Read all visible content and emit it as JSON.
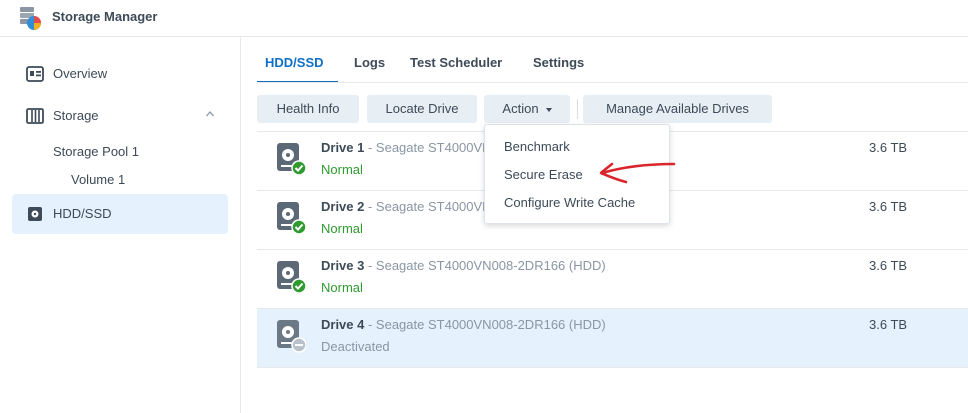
{
  "app": {
    "title": "Storage Manager"
  },
  "sidebar": {
    "items": [
      {
        "label": "Overview",
        "icon": "overview-icon"
      },
      {
        "label": "Storage",
        "icon": "storage-icon",
        "expanded": true
      },
      {
        "label": "HDD/SSD",
        "icon": "hdd-icon",
        "active": true
      }
    ],
    "storage_children": [
      {
        "label": "Storage Pool 1"
      },
      {
        "label": "Volume 1"
      }
    ]
  },
  "tabs": [
    {
      "label": "HDD/SSD",
      "active": true
    },
    {
      "label": "Logs"
    },
    {
      "label": "Test Scheduler"
    },
    {
      "label": "Settings"
    }
  ],
  "toolbar": {
    "health_info": "Health Info",
    "locate_drive": "Locate Drive",
    "action": "Action",
    "manage_drives": "Manage Available Drives"
  },
  "action_menu": {
    "items": [
      "Benchmark",
      "Secure Erase",
      "Configure Write Cache"
    ],
    "annotation_color": "#d9262c"
  },
  "drives": [
    {
      "name": "Drive 1",
      "model": " - Seagate ST4000VN008-2DR166 (HDD)",
      "status": "Normal",
      "size": "3.6 TB",
      "state": "ok"
    },
    {
      "name": "Drive 2",
      "model": " - Seagate ST4000VN008-2DR166 (HDD)",
      "status": "Normal",
      "size": "3.6 TB",
      "state": "ok"
    },
    {
      "name": "Drive 3",
      "model": " - Seagate ST4000VN008-2DR166 (HDD)",
      "status": "Normal",
      "size": "3.6 TB",
      "state": "ok"
    },
    {
      "name": "Drive 4",
      "model": " - Seagate ST4000VN008-2DR166 (HDD)",
      "status": "Deactivated",
      "size": "3.6 TB",
      "state": "deactivated",
      "selected": true
    }
  ],
  "colors": {
    "accent": "#0f6fc6",
    "ok": "#2f9a2f",
    "selected_bg": "#e5f1fc"
  }
}
